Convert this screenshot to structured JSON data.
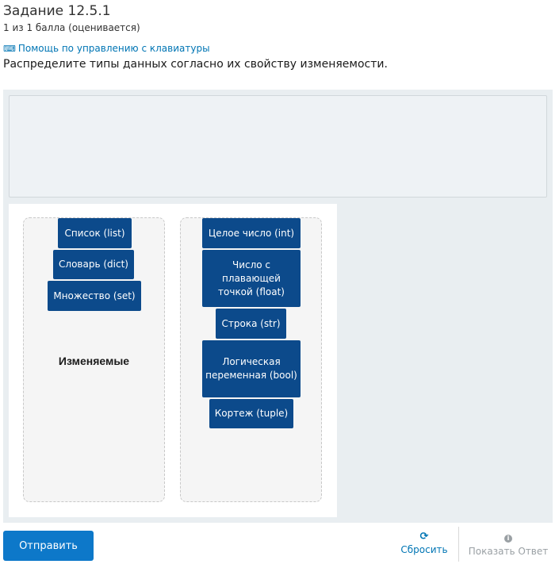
{
  "header": {
    "title": "Задание 12.5.1",
    "score": "1 из 1 балла (оценивается)",
    "help_link": "Помощь по управлению с клавиатуры",
    "prompt": "Распределите типы данных согласно их свойству изменяемости."
  },
  "zones": {
    "mutable_label": "Изменяемые",
    "mutable_items": [
      "Список (list)",
      "Словарь (dict)",
      "Множество (set)"
    ],
    "immutable_items": [
      "Целое число (int)",
      "Число с плавающей точкой (float)",
      "Строка (str)",
      "Логическая переменная (bool)",
      "Кортеж (tuple)"
    ]
  },
  "footer": {
    "submit_label": "Отправить",
    "reset_label": "Сбросить",
    "show_answer_label": "Показать Ответ"
  },
  "colors": {
    "item_bg": "#0c4a8b",
    "submit_bg": "#0d78c9",
    "link": "#0075b4"
  },
  "icons": {
    "help": "keyboard-icon",
    "reset": "refresh-icon",
    "show_answer": "info-icon"
  }
}
